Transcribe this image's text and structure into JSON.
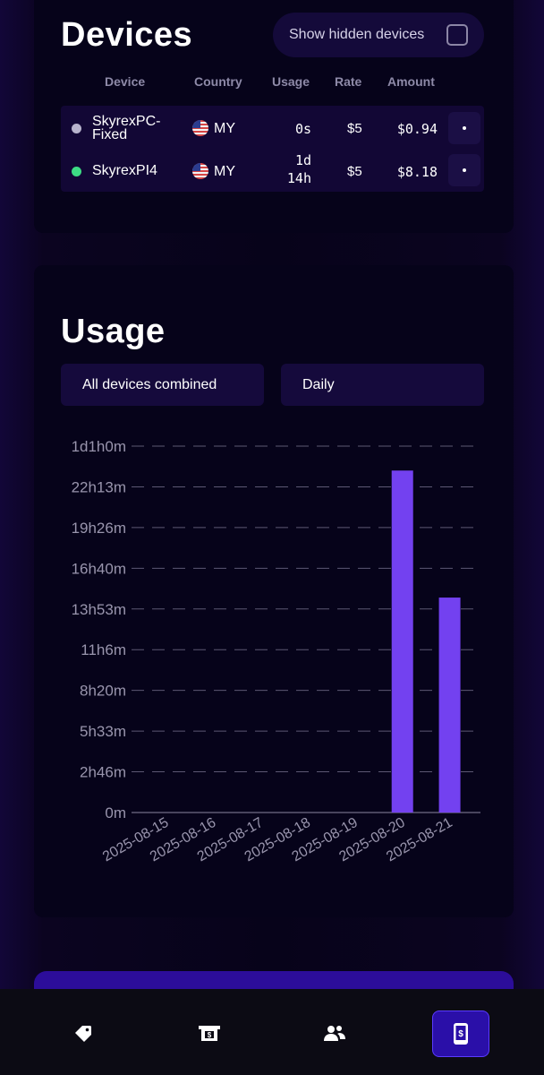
{
  "devices": {
    "title": "Devices",
    "show_hidden_label": "Show hidden devices",
    "show_hidden_checked": false,
    "columns": [
      "Device",
      "Country",
      "Usage",
      "Rate",
      "Amount"
    ],
    "rows": [
      {
        "status_color": "#b7b3cc",
        "name_line1": "SkyrexPC-",
        "name_line2": "Fixed",
        "country": "MY",
        "usage_line1": "0s",
        "usage_line2": "",
        "rate": "$5",
        "amount": "$0.94"
      },
      {
        "status_color": "#3ddc84",
        "name_line1": "SkyrexPI4",
        "name_line2": "",
        "country": "MY",
        "usage_line1": "1d",
        "usage_line2": "14h",
        "rate": "$5",
        "amount": "$8.18"
      }
    ]
  },
  "usage": {
    "title": "Usage",
    "device_select": "All devices combined",
    "period_select": "Daily"
  },
  "chart_data": {
    "type": "bar",
    "categories": [
      "2025-08-15",
      "2025-08-16",
      "2025-08-17",
      "2025-08-18",
      "2025-08-19",
      "2025-08-20",
      "2025-08-21"
    ],
    "values_minutes": [
      0,
      0,
      0,
      0,
      0,
      1400,
      880
    ],
    "y_tick_labels": [
      "0m",
      "2h46m",
      "5h33m",
      "8h20m",
      "11h6m",
      "13h53m",
      "16h40m",
      "19h26m",
      "22h13m",
      "1d1h0m"
    ],
    "y_tick_minutes": [
      0,
      166.7,
      333.3,
      500,
      666.7,
      833.3,
      1000,
      1166.7,
      1333.3,
      1500
    ],
    "ylim_minutes": [
      0,
      1500
    ],
    "bar_color": "#7341f0",
    "grid": "dashed-horizontal",
    "xlabel": "",
    "ylabel": ""
  },
  "nav": {
    "items": [
      "tag-icon",
      "money-icon",
      "users-icon",
      "phone-dollar-icon"
    ],
    "active": 3
  },
  "colors": {
    "accent": "#7341f0",
    "active_nav": "#2a0fa8"
  }
}
